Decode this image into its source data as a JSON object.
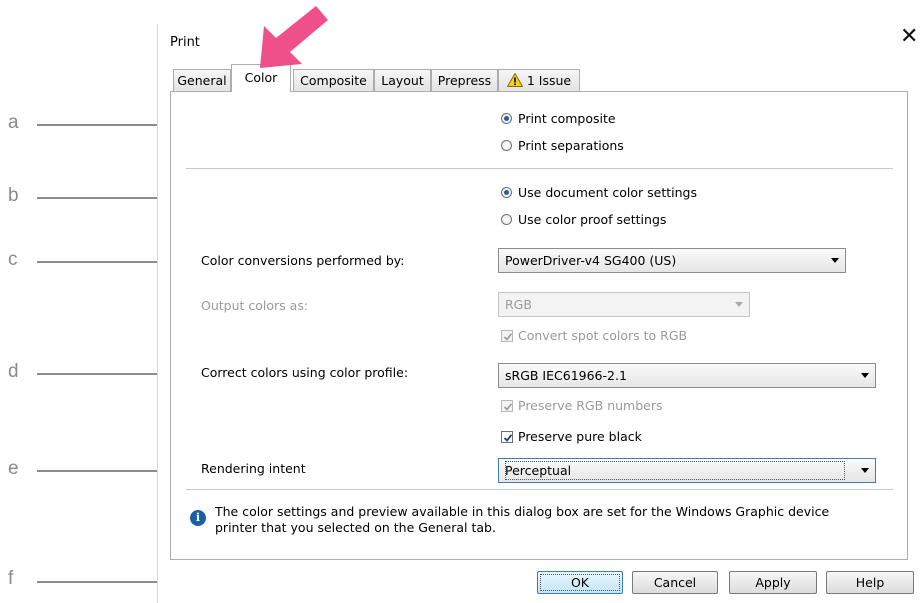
{
  "callouts": {
    "a": "a",
    "b": "b",
    "c": "c",
    "d": "d",
    "e": "e",
    "f": "f"
  },
  "dialog": {
    "title": "Print"
  },
  "tabs": [
    "General",
    "Color",
    "Composite",
    "Layout",
    "Prepress",
    "1 Issue"
  ],
  "active_tab": "Color",
  "print_mode": {
    "composite": "Print composite",
    "separations": "Print separations",
    "selected": "composite"
  },
  "color_source": {
    "document": "Use document color settings",
    "proof": "Use color proof settings",
    "selected": "document"
  },
  "conversions": {
    "label": "Color conversions performed by:",
    "value": "PowerDriver-v4 SG400 (US)"
  },
  "output": {
    "label": "Output colors as:",
    "value": "RGB",
    "convert_spot": "Convert spot colors to RGB",
    "convert_spot_checked": true
  },
  "profile": {
    "label": "Correct colors using color profile:",
    "value": "sRGB IEC61966-2.1",
    "preserve_rgb": "Preserve RGB numbers",
    "preserve_rgb_checked": true,
    "preserve_black": "Preserve pure black",
    "preserve_black_checked": true
  },
  "rendering": {
    "label": "Rendering intent",
    "value": "Perceptual"
  },
  "info": "The color settings and preview available in this dialog box are set for the Windows Graphic device printer that you selected on the General tab.",
  "buttons": {
    "ok": "OK",
    "cancel": "Cancel",
    "apply": "Apply",
    "help": "Help"
  },
  "colors": {
    "arrow": "#f0508a",
    "accent": "#1f5fa8",
    "callout": "#8a8a8a"
  }
}
